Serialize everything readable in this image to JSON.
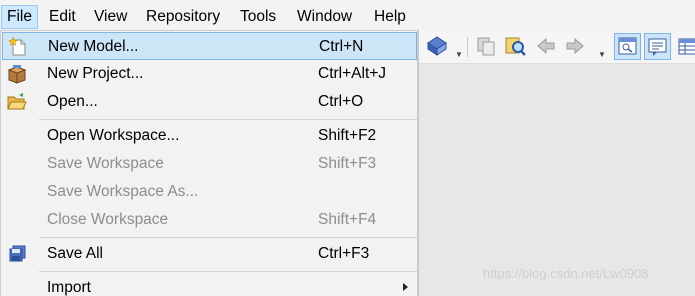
{
  "menubar": {
    "items": [
      {
        "label": "File",
        "active": true
      },
      {
        "label": "Edit"
      },
      {
        "label": "View"
      },
      {
        "label": "Repository"
      },
      {
        "label": "Tools"
      },
      {
        "label": "Window"
      },
      {
        "label": "Help"
      }
    ]
  },
  "file_menu": {
    "items": [
      {
        "label": "New Model...",
        "shortcut": "Ctrl+N",
        "icon": "new-model-icon",
        "highlighted": true,
        "enabled": true
      },
      {
        "label": "New Project...",
        "shortcut": "Ctrl+Alt+J",
        "icon": "new-project-icon",
        "enabled": true
      },
      {
        "label": "Open...",
        "shortcut": "Ctrl+O",
        "icon": "open-folder-icon",
        "enabled": true
      },
      {
        "label": "Open Workspace...",
        "shortcut": "Shift+F2",
        "enabled": true
      },
      {
        "label": "Save Workspace",
        "shortcut": "Shift+F3",
        "enabled": false
      },
      {
        "label": "Save Workspace As...",
        "shortcut": "",
        "enabled": false
      },
      {
        "label": "Close Workspace",
        "shortcut": "Shift+F4",
        "enabled": false
      },
      {
        "label": "Save All",
        "shortcut": "Ctrl+F3",
        "icon": "save-all-icon",
        "enabled": true
      },
      {
        "label": "Import",
        "shortcut": "",
        "submenu": true,
        "enabled": true
      }
    ]
  },
  "toolbar": {
    "icons": [
      "model-check-icon",
      "copy-icon",
      "find-icon",
      "back-arrow-icon",
      "forward-arrow-icon",
      "browser-toggle-icon",
      "output-toggle-icon",
      "result-list-icon"
    ]
  },
  "watermark": {
    "text": "https://blog.csdn.net/Lw0908"
  },
  "colors": {
    "menu_highlight": "#cce6f7",
    "menu_highlight_border": "#7fb6e6",
    "disabled_text": "#8d8d8d",
    "menu_background": "#f2f2f2",
    "workspace_background": "#e7e7e7"
  }
}
